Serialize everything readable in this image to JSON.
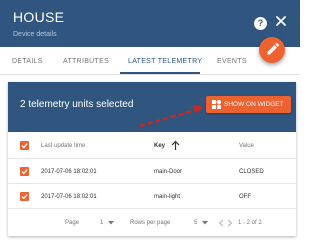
{
  "header": {
    "title": "HOUSE",
    "subtitle": "Device details"
  },
  "tabs": [
    {
      "label": "DETAILS"
    },
    {
      "label": "ATTRIBUTES"
    },
    {
      "label": "LATEST TELEMETRY"
    },
    {
      "label": "EVENTS"
    }
  ],
  "active_tab": "LATEST TELEMETRY",
  "selection": {
    "text": "2 telemetry units selected",
    "button_label": "SHOW ON WIDGET"
  },
  "table": {
    "columns": [
      "Last update time",
      "Key",
      "Value"
    ],
    "rows": [
      {
        "time": "2017-07-06 18:02:01",
        "key": "main-Door",
        "value": "CLOSED"
      },
      {
        "time": "2017-07-06 18:02:01",
        "key": "main-light",
        "value": "OFF"
      }
    ]
  },
  "pagination": {
    "page_label": "Page",
    "page_value": "1",
    "rows_label": "Rows per page",
    "rows_value": "5",
    "range": "1 - 2 of 2"
  },
  "colors": {
    "header_bg": "#305680",
    "accent": "#ee6231"
  },
  "icons": [
    "help-icon",
    "close-icon",
    "edit-icon",
    "widgets-icon",
    "sort-arrow-up-icon",
    "dropdown-arrow-icon",
    "chevron-left-icon",
    "chevron-right-icon",
    "checkbox-checked-icon",
    "red-arrow-annotation"
  ]
}
